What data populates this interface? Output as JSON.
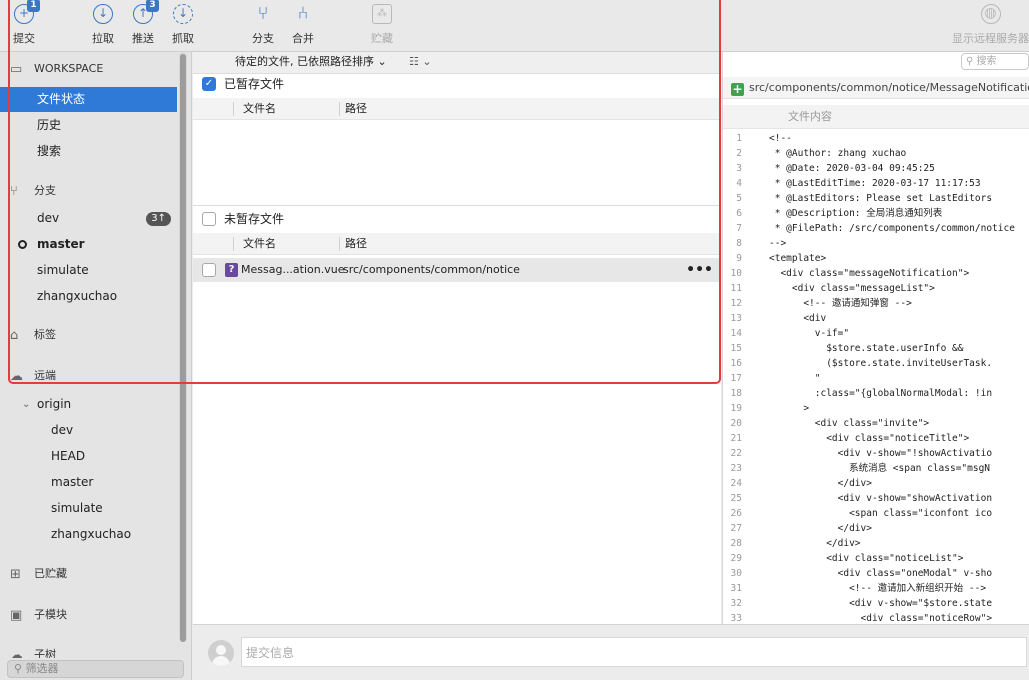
{
  "toolbar": {
    "commit": {
      "label": "提交",
      "badge": "1"
    },
    "pull": {
      "label": "拉取"
    },
    "push": {
      "label": "推送",
      "badge": "3"
    },
    "fetch": {
      "label": "抓取"
    },
    "branch": {
      "label": "分支"
    },
    "merge": {
      "label": "合并"
    },
    "stash": {
      "label": "贮藏"
    },
    "remote": {
      "label": "显示远程服务器"
    }
  },
  "sidebar": {
    "workspace": "WORKSPACE",
    "file_status": "文件状态",
    "history": "历史",
    "search": "搜索",
    "branches_header": "分支",
    "branches": [
      {
        "name": "dev",
        "badge": "3↑"
      },
      {
        "name": "master",
        "current": true
      },
      {
        "name": "simulate"
      },
      {
        "name": "zhangxuchao"
      }
    ],
    "tags_header": "标签",
    "remotes_header": "远端",
    "remote_origin": "origin",
    "remote_branches": [
      "dev",
      "HEAD",
      "master",
      "simulate",
      "zhangxuchao"
    ],
    "stashes_header": "已贮藏",
    "submodules_header": "子模块",
    "subtrees_header": "子树",
    "filter_placeholder": "筛选器"
  },
  "middle": {
    "sort_label": "待定的文件, 已依照路径排序",
    "staged_label": "已暂存文件",
    "unstaged_label": "未暂存文件",
    "col_filename": "文件名",
    "col_path": "路径",
    "unstaged_files": [
      {
        "name": "Messag...ation.vue",
        "path": "src/components/common/notice",
        "status": "?"
      }
    ]
  },
  "right": {
    "search_placeholder": "搜索",
    "file_path": "src/components/common/notice/MessageNotification.vue",
    "content_header": "文件内容",
    "code_lines": [
      {
        "n": "1",
        "t": "<!--"
      },
      {
        "n": "2",
        "t": " * @Author: zhang xuchao"
      },
      {
        "n": "3",
        "t": " * @Date: 2020-03-04 09:45:25"
      },
      {
        "n": "4",
        "t": " * @LastEditTime: 2020-03-17 11:17:53"
      },
      {
        "n": "5",
        "t": " * @LastEditors: Please set LastEditors"
      },
      {
        "n": "6",
        "t": " * @Description: 全局消息通知列表"
      },
      {
        "n": "7",
        "t": " * @FilePath: /src/components/common/notice"
      },
      {
        "n": "8",
        "t": "-->"
      },
      {
        "n": "9",
        "t": "<template>"
      },
      {
        "n": "10",
        "t": "  <div class=\"messageNotification\">"
      },
      {
        "n": "11",
        "t": "    <div class=\"messageList\">"
      },
      {
        "n": "12",
        "t": "      <!-- 邀请通知弹窗 -->"
      },
      {
        "n": "13",
        "t": "      <div"
      },
      {
        "n": "14",
        "t": "        v-if=\""
      },
      {
        "n": "15",
        "t": "          $store.state.userInfo &&"
      },
      {
        "n": "16",
        "t": "          ($store.state.inviteUserTask."
      },
      {
        "n": "17",
        "t": "        \""
      },
      {
        "n": "18",
        "t": "        :class=\"{globalNormalModal: !in"
      },
      {
        "n": "19",
        "t": "      >"
      },
      {
        "n": "20",
        "t": "        <div class=\"invite\">"
      },
      {
        "n": "21",
        "t": "          <div class=\"noticeTitle\">"
      },
      {
        "n": "22",
        "t": "            <div v-show=\"!showActivatio"
      },
      {
        "n": "23",
        "t": "              系统消息 <span class=\"msgN"
      },
      {
        "n": "24",
        "t": "            </div>"
      },
      {
        "n": "25",
        "t": "            <div v-show=\"showActivation"
      },
      {
        "n": "26",
        "t": "              <span class=\"iconfont ico"
      },
      {
        "n": "27",
        "t": "            </div>"
      },
      {
        "n": "28",
        "t": "          </div>"
      },
      {
        "n": "29",
        "t": "          <div class=\"noticeList\">"
      },
      {
        "n": "30",
        "t": "            <div class=\"oneModal\" v-sho"
      },
      {
        "n": "31",
        "t": "              <!-- 邀请加入新组织开始 -->"
      },
      {
        "n": "32",
        "t": "              <div v-show=\"$store.state"
      },
      {
        "n": "33",
        "t": "                <div class=\"noticeRow\">"
      }
    ]
  },
  "commit": {
    "placeholder": "提交信息"
  },
  "colors": {
    "accent": "#2f7ad6",
    "highlight": "#e23d3d",
    "added": "#3fa34d",
    "untracked": "#6a4a9c"
  }
}
